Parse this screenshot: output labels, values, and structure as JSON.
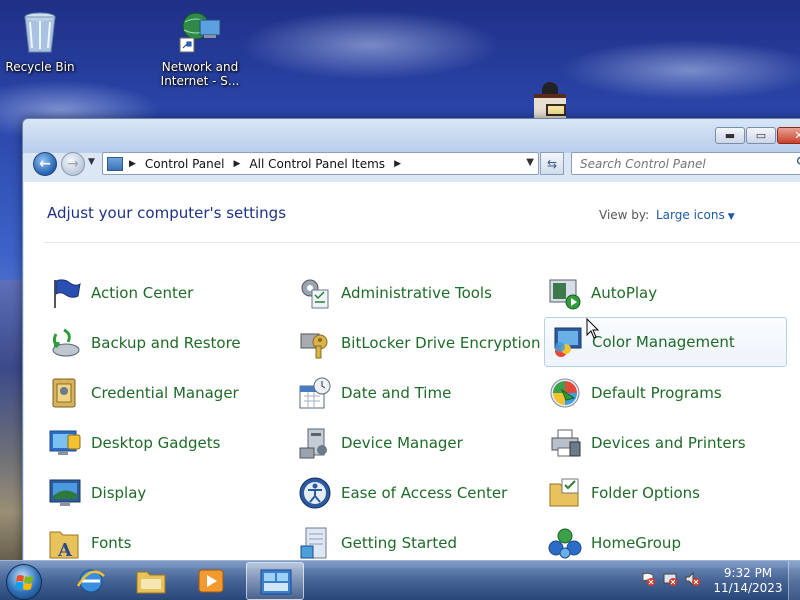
{
  "desktop": {
    "icons": [
      {
        "label": "Recycle Bin",
        "icon": "recycle-bin-icon"
      },
      {
        "label": "Network and Internet - S...",
        "icon": "network-icon"
      }
    ]
  },
  "window": {
    "address": {
      "crumbs": [
        "Control Panel",
        "All Control Panel Items"
      ]
    },
    "search": {
      "placeholder": "Search Control Panel"
    },
    "heading": "Adjust your computer's settings",
    "view_by": {
      "label": "View by:",
      "value": "Large icons"
    },
    "items": [
      {
        "label": "Action Center",
        "icon": "action-center-flag-icon"
      },
      {
        "label": "Administrative Tools",
        "icon": "administrative-tools-icon"
      },
      {
        "label": "AutoPlay",
        "icon": "autoplay-icon"
      },
      {
        "label": "Backup and Restore",
        "icon": "backup-restore-icon"
      },
      {
        "label": "BitLocker Drive Encryption",
        "icon": "bitlocker-key-icon"
      },
      {
        "label": "Color Management",
        "icon": "color-management-icon"
      },
      {
        "label": "Credential Manager",
        "icon": "credential-manager-icon"
      },
      {
        "label": "Date and Time",
        "icon": "date-time-icon"
      },
      {
        "label": "Default Programs",
        "icon": "default-programs-icon"
      },
      {
        "label": "Desktop Gadgets",
        "icon": "desktop-gadgets-icon"
      },
      {
        "label": "Device Manager",
        "icon": "device-manager-icon"
      },
      {
        "label": "Devices and Printers",
        "icon": "devices-printers-icon"
      },
      {
        "label": "Display",
        "icon": "display-icon"
      },
      {
        "label": "Ease of Access Center",
        "icon": "ease-of-access-icon"
      },
      {
        "label": "Folder Options",
        "icon": "folder-options-icon"
      },
      {
        "label": "Fonts",
        "icon": "fonts-icon"
      },
      {
        "label": "Getting Started",
        "icon": "getting-started-icon"
      },
      {
        "label": "HomeGroup",
        "icon": "homegroup-icon"
      }
    ]
  },
  "taskbar": {
    "clock": {
      "time": "9:32 PM",
      "date": "11/14/2023"
    }
  },
  "colors": {
    "link_green": "#1e6b27",
    "heading_blue": "#1e3287",
    "accent_blue": "#1e5aa6"
  }
}
